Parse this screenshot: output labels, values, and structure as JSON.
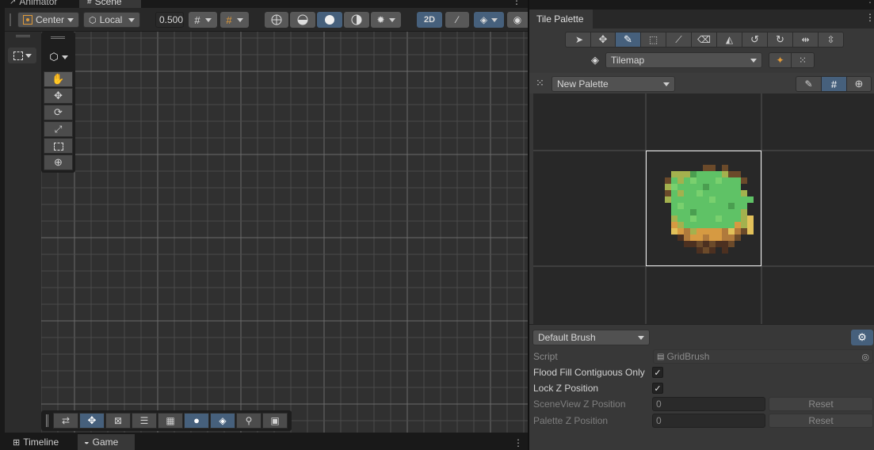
{
  "scene_panel": {
    "tabs": [
      {
        "label": "Animator"
      },
      {
        "label": "Scene"
      }
    ],
    "toolbar": {
      "pivot_mode": "Center",
      "pivot_rotation": "Local",
      "snap_value": "0.500",
      "mode_2d": "2D"
    }
  },
  "bottom_tabs": [
    {
      "label": "Timeline"
    },
    {
      "label": "Game"
    }
  ],
  "tile_palette": {
    "tab_title": "Tile Palette",
    "target_dropdown": "Tilemap",
    "palette_dropdown": "New Palette",
    "brush_dropdown": "Default Brush",
    "properties": {
      "script_label": "Script",
      "script_value": "GridBrush",
      "flood_fill_label": "Flood Fill Contiguous Only",
      "flood_fill_checked": true,
      "lock_z_label": "Lock Z Position",
      "lock_z_checked": true,
      "sceneview_z_label": "SceneView Z Position",
      "sceneview_z_value": "0",
      "palette_z_label": "Palette Z Position",
      "palette_z_value": "0",
      "reset_label": "Reset"
    }
  },
  "colors": {
    "accent_active": "#46607c",
    "scene_background": "#303030",
    "tile_green": "#5fc266"
  }
}
